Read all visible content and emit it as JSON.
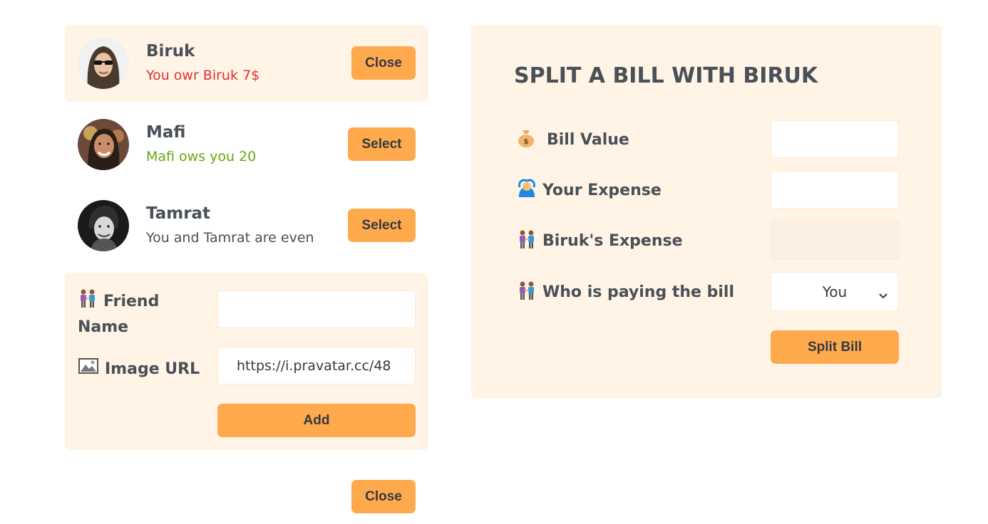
{
  "friends": [
    {
      "name": "Biruk",
      "status": "You owr Biruk 7$",
      "button": "Close"
    },
    {
      "name": "Mafi",
      "status": "Mafi ows you 20",
      "button": "Select"
    },
    {
      "name": "Tamrat",
      "status": "You and Tamrat are even",
      "button": "Select"
    }
  ],
  "add_form": {
    "friend_name_label": "Friend Name",
    "image_url_label": "Image URL",
    "friend_name_value": "",
    "image_url_value": "https://i.pravatar.cc/48",
    "add_button": "Add"
  },
  "close_button": "Close",
  "split_form": {
    "title": "SPLIT A BILL WITH BIRUK",
    "bill_value_label": "Bill Value",
    "your_expense_label": "Your Expense",
    "friend_expense_label": "Biruk's Expense",
    "who_pays_label": "Who is paying the bill",
    "who_pays_selected": "You",
    "split_button": "Split Bill"
  },
  "colors": {
    "accent": "#ffa94d",
    "panel_bg": "#fff4e6",
    "owe_red": "#e03131",
    "owed_green": "#66a80f",
    "text": "#495057"
  },
  "icons": {
    "people": "people-holding-hands-icon",
    "money_bag": "money-bag-icon",
    "person_gesture": "person-gesturing-ok-icon",
    "image": "framed-picture-icon",
    "chevron": "chevron-down-icon"
  }
}
